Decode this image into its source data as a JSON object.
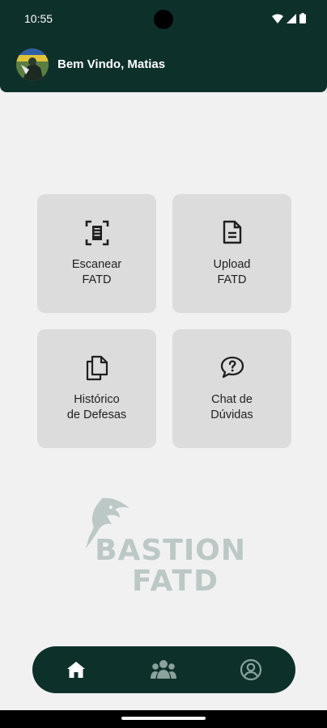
{
  "status_bar": {
    "time": "10:55",
    "icons": [
      "wifi-icon",
      "signal-icon",
      "battery-icon"
    ]
  },
  "header": {
    "greeting": "Bem Vindo, Matias",
    "avatar": "user-avatar"
  },
  "tiles": [
    {
      "label": "Escanear\nFATD",
      "icon": "scan-icon"
    },
    {
      "label": "Upload\nFATD",
      "icon": "document-icon"
    },
    {
      "label": "Histórico\nde Defesas",
      "icon": "copy-documents-icon"
    },
    {
      "label": "Chat de\nDúvidas",
      "icon": "question-chat-icon"
    }
  ],
  "logo": {
    "line1": "BASTION",
    "line2": "FATD",
    "icon": "eagle-logo-icon"
  },
  "bottom_nav": {
    "items": [
      {
        "icon": "home-icon",
        "active": true
      },
      {
        "icon": "group-icon",
        "active": false
      },
      {
        "icon": "account-circle-icon",
        "active": false
      }
    ]
  },
  "colors": {
    "primary_dark": "#0e302b",
    "tile_bg": "#dcdcdc",
    "page_bg": "#f1f1f1",
    "logo_tint": "#bcc8c6"
  }
}
